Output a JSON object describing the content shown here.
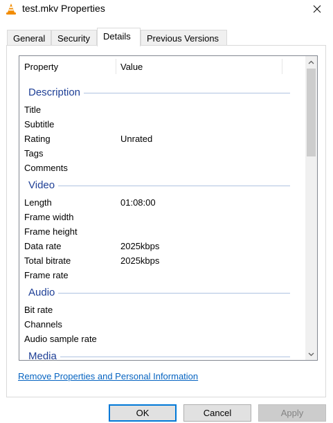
{
  "window": {
    "title": "test.mkv Properties",
    "icon": "vlc-cone-icon",
    "close_glyph": "✕"
  },
  "tabs": [
    {
      "label": "General",
      "active": false
    },
    {
      "label": "Security",
      "active": false
    },
    {
      "label": "Details",
      "active": true
    },
    {
      "label": "Previous Versions",
      "active": false
    }
  ],
  "details": {
    "columns": {
      "property": "Property",
      "value": "Value"
    },
    "groups": [
      {
        "name": "Description",
        "rows": [
          {
            "property": "Title",
            "value": ""
          },
          {
            "property": "Subtitle",
            "value": ""
          },
          {
            "property": "Rating",
            "value": "Unrated"
          },
          {
            "property": "Tags",
            "value": ""
          },
          {
            "property": "Comments",
            "value": ""
          }
        ]
      },
      {
        "name": "Video",
        "rows": [
          {
            "property": "Length",
            "value": "01:08:00"
          },
          {
            "property": "Frame width",
            "value": ""
          },
          {
            "property": "Frame height",
            "value": ""
          },
          {
            "property": "Data rate",
            "value": "2025kbps"
          },
          {
            "property": "Total bitrate",
            "value": "2025kbps"
          },
          {
            "property": "Frame rate",
            "value": ""
          }
        ]
      },
      {
        "name": "Audio",
        "rows": [
          {
            "property": "Bit rate",
            "value": ""
          },
          {
            "property": "Channels",
            "value": ""
          },
          {
            "property": "Audio sample rate",
            "value": ""
          }
        ]
      },
      {
        "name": "Media",
        "rows": []
      }
    ]
  },
  "remove_link": "Remove Properties and Personal Information",
  "buttons": {
    "ok": "OK",
    "cancel": "Cancel",
    "apply": "Apply"
  },
  "colors": {
    "group_header": "#1e3f96",
    "link": "#0563c1",
    "default_button_border": "#0078d7"
  }
}
